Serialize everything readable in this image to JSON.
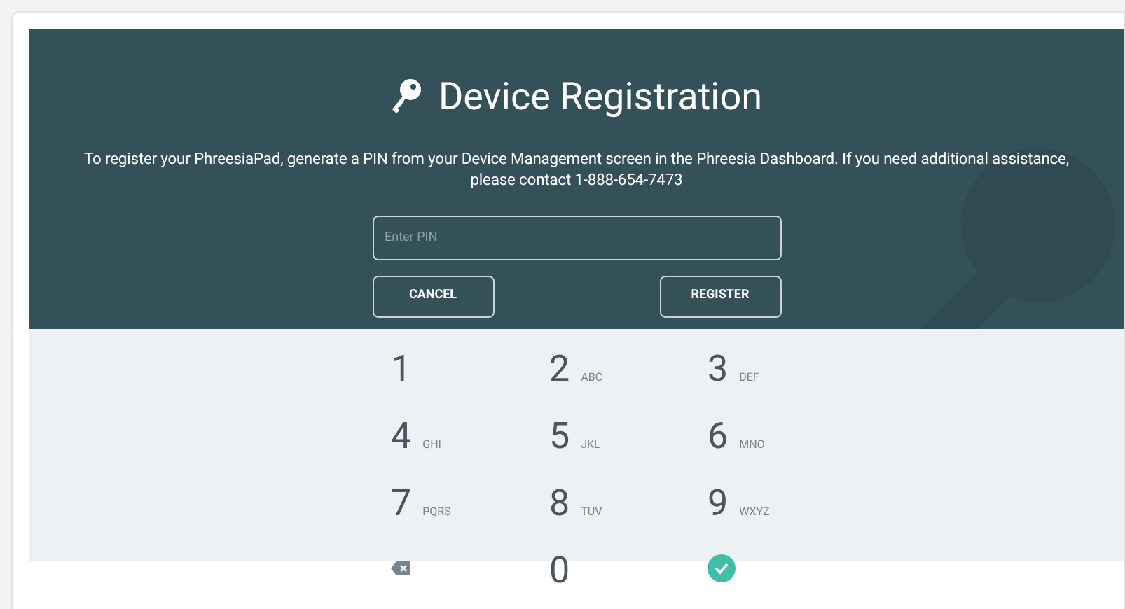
{
  "header": {
    "title": "Device Registration",
    "instructions": "To register your PhreesiaPad, generate a PIN from your Device Management screen in the Phreesia Dashboard. If you need additional assistance, please contact 1-888-654-7473"
  },
  "pin_field": {
    "placeholder": "Enter PIN"
  },
  "buttons": [
    {
      "label": "CANCEL"
    },
    {
      "label": "REGISTER"
    }
  ],
  "keypad": [
    {
      "kind": "digit",
      "digit": "1"
    },
    {
      "kind": "digit",
      "digit": "2",
      "letters": "ABC"
    },
    {
      "kind": "digit",
      "digit": "3",
      "letters": "DEF"
    },
    {
      "kind": "digit",
      "digit": "4",
      "letters": "GHI"
    },
    {
      "kind": "digit",
      "digit": "5",
      "letters": "JKL"
    },
    {
      "kind": "digit",
      "digit": "6",
      "letters": "MNO"
    },
    {
      "kind": "digit",
      "digit": "7",
      "letters": "PQRS"
    },
    {
      "kind": "digit",
      "digit": "8",
      "letters": "TUV"
    },
    {
      "kind": "digit",
      "digit": "9",
      "letters": "WXYZ"
    },
    {
      "kind": "backspace"
    },
    {
      "kind": "digit",
      "digit": "0"
    },
    {
      "kind": "confirm"
    }
  ]
}
